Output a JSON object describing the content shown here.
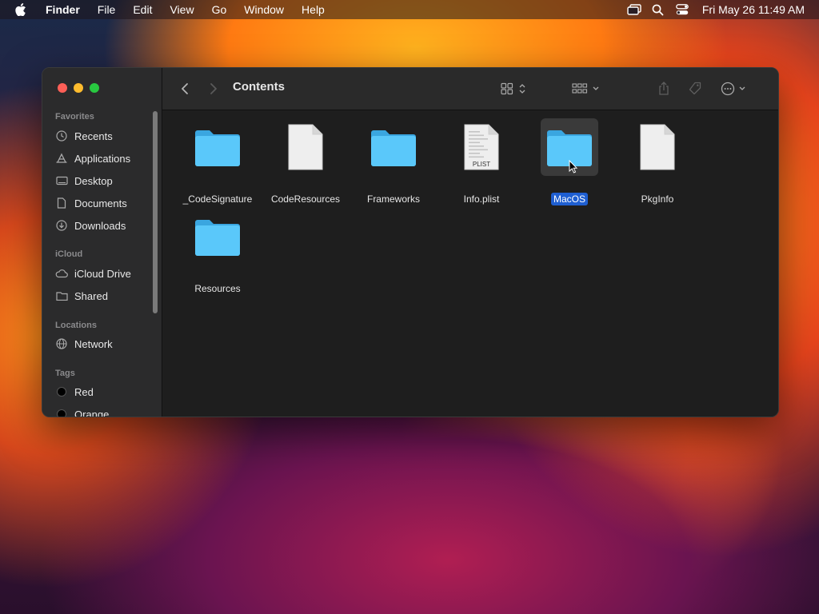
{
  "menubar": {
    "app_name": "Finder",
    "items": [
      "File",
      "Edit",
      "View",
      "Go",
      "Window",
      "Help"
    ],
    "clock": "Fri May 26  11:49 AM"
  },
  "window": {
    "title": "Contents",
    "sidebar": {
      "favorites_label": "Favorites",
      "favorites": [
        {
          "label": "Recents",
          "icon": "clock-icon"
        },
        {
          "label": "Applications",
          "icon": "applications-icon"
        },
        {
          "label": "Desktop",
          "icon": "desktop-icon"
        },
        {
          "label": "Documents",
          "icon": "document-icon"
        },
        {
          "label": "Downloads",
          "icon": "download-icon"
        }
      ],
      "icloud_label": "iCloud",
      "icloud": [
        {
          "label": "iCloud Drive",
          "icon": "cloud-icon"
        },
        {
          "label": "Shared",
          "icon": "shared-folder-icon"
        }
      ],
      "locations_label": "Locations",
      "locations": [
        {
          "label": "Network",
          "icon": "globe-icon"
        }
      ],
      "tags_label": "Tags",
      "tags": [
        {
          "label": "Red"
        },
        {
          "label": "Orange"
        }
      ]
    },
    "files": [
      {
        "name": "_CodeSignature",
        "type": "folder",
        "selected": false
      },
      {
        "name": "CodeResources",
        "type": "file",
        "selected": false
      },
      {
        "name": "Frameworks",
        "type": "folder",
        "selected": false
      },
      {
        "name": "Info.plist",
        "type": "plist",
        "badge": "PLIST",
        "selected": false
      },
      {
        "name": "MacOS",
        "type": "folder",
        "selected": true
      },
      {
        "name": "PkgInfo",
        "type": "file",
        "selected": false
      },
      {
        "name": "Resources",
        "type": "folder",
        "selected": false
      }
    ]
  },
  "colors": {
    "folder": "#5ac8fa",
    "selection": "#1f5fd1"
  }
}
